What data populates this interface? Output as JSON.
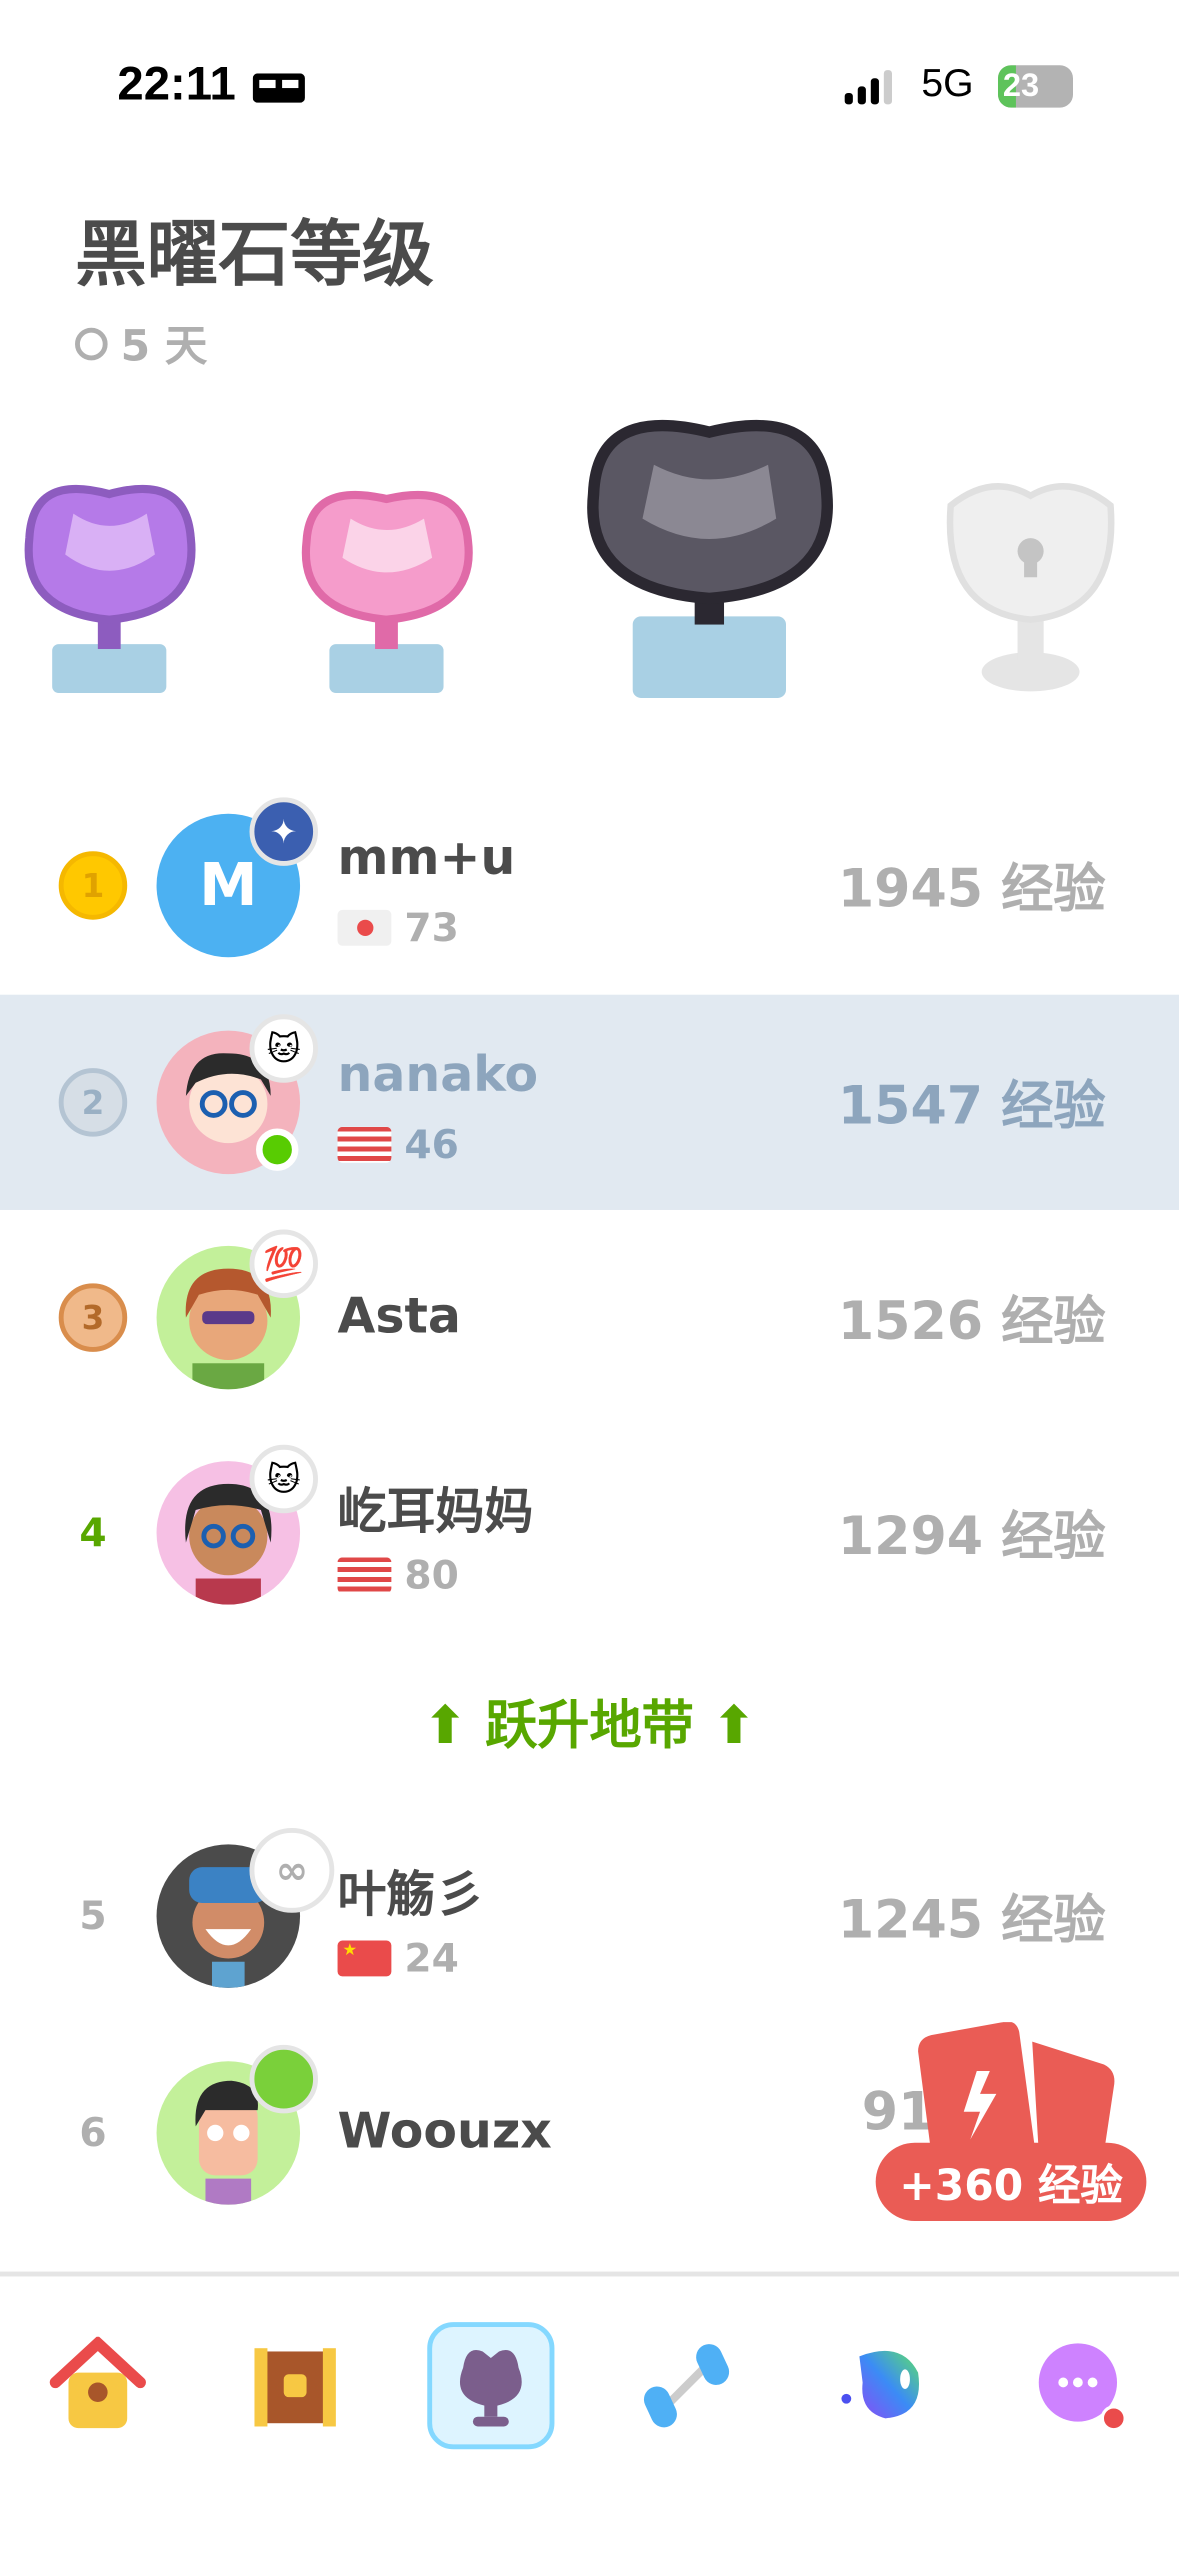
{
  "status_bar": {
    "time": "22:11",
    "network": "5G",
    "battery": "23"
  },
  "header": {
    "title": "黑曜石等级",
    "days_left": "5 天"
  },
  "leaderboard": [
    {
      "rank": "1",
      "name": "mm+u",
      "initial": "M",
      "streak": "73",
      "xp": "1945 经验",
      "flag": "japan"
    },
    {
      "rank": "2",
      "name": "nanako",
      "streak": "46",
      "xp": "1547 经验",
      "flag": "usa",
      "current_user": true
    },
    {
      "rank": "3",
      "name": "Asta",
      "xp": "1526 经验",
      "badge": "💯"
    },
    {
      "rank": "4",
      "name": "屹耳妈妈",
      "streak": "80",
      "xp": "1294 经验",
      "flag": "usa"
    },
    {
      "rank": "5",
      "name": "叶觞彡",
      "streak": "24",
      "xp": "1245 经验",
      "flag": "china"
    },
    {
      "rank": "6",
      "name": "Woouzx",
      "xp": "91"
    }
  ],
  "promotion_zone": {
    "label": "跃升地带"
  },
  "boost": {
    "label": "+360 经验"
  },
  "nav": [
    "home",
    "chest",
    "leaderboard",
    "practice",
    "max",
    "more"
  ],
  "colors": {
    "accent_green": "#58a700",
    "highlight_row": "#e1e9f1",
    "boost_red": "#ea5c55"
  }
}
